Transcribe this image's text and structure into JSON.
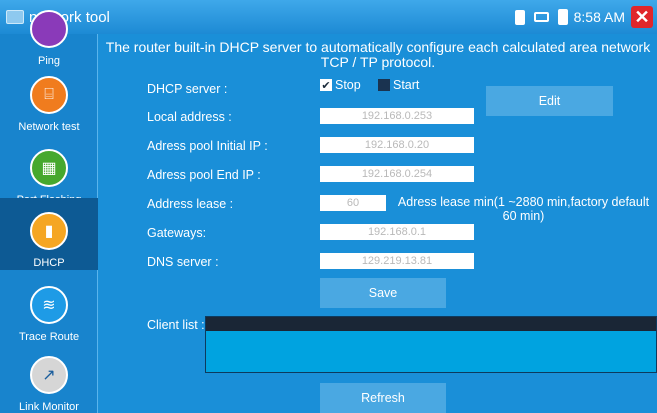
{
  "titlebar": {
    "title": "network tool",
    "time": "8:58 AM"
  },
  "sidebar": {
    "items": [
      {
        "label": "Ping",
        "icon": "ping-icon",
        "color": "#8a3ab9"
      },
      {
        "label": "Network test",
        "icon": "network-test-icon",
        "color": "#f07c1e"
      },
      {
        "label": "Port Flashing",
        "icon": "port-flashing-icon",
        "color": "#46a82e"
      },
      {
        "label": "DHCP",
        "icon": "dhcp-icon",
        "color": "#f5a623",
        "active": true
      },
      {
        "label": "Trace Route",
        "icon": "trace-route-icon",
        "color": "#1e9be6"
      },
      {
        "label": "Link Monitor",
        "icon": "link-monitor-icon",
        "color": "#c9c9c9"
      }
    ]
  },
  "main": {
    "headline": "The router built-in DHCP server to automatically configure each calculated area network TCP / TP protocol.",
    "dhcp_server": {
      "label": "DHCP server :",
      "stop": "Stop",
      "start": "Start",
      "selected": "Stop"
    },
    "edit_label": "Edit",
    "fields": [
      {
        "label": "Local address :",
        "value": "192.168.0.253"
      },
      {
        "label": "Adress pool Initial IP :",
        "value": "192.168.0.20"
      },
      {
        "label": "Adress pool End IP :",
        "value": "192.168.0.254"
      },
      {
        "label": "Address lease :",
        "value": "60"
      },
      {
        "label": "Gateways:",
        "value": "192.168.0.1"
      },
      {
        "label": "DNS server :",
        "value": "129.219.13.81"
      }
    ],
    "lease_note": "Adress lease min(1 ~2880 min,factory default 60 min)",
    "save_label": "Save",
    "client_list_label": "Client list :",
    "refresh_label": "Refresh"
  }
}
